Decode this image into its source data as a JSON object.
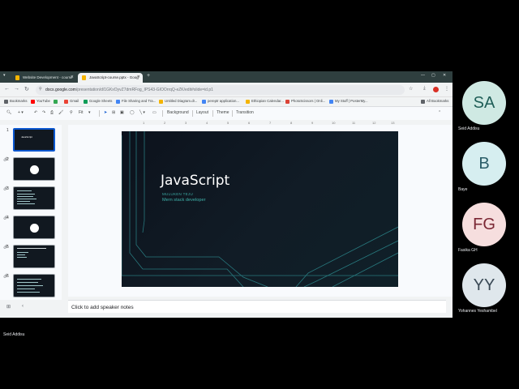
{
  "browser": {
    "tabs": [
      {
        "title": "Website Development - course"
      },
      {
        "title": "JavaScript-course.pptx - Goog"
      }
    ],
    "new_tab": "+",
    "url_host": "docs.google.com",
    "url_path": "/presentation/d/1GKxOyvZ7dmRFog_IPS43-GIOOrrqQ-eZK/edit#slide=id.p1",
    "bookmarks": [
      {
        "label": "Bookmarks",
        "color": "#5f6368"
      },
      {
        "label": "YouTube",
        "color": "#ff0000"
      },
      {
        "label": "",
        "color": "#34a853"
      },
      {
        "label": "Gmail",
        "color": "#ea4335"
      },
      {
        "label": "Google Sheets",
        "color": "#0f9d58"
      },
      {
        "label": "File Sharing and Tra...",
        "color": "#4285f4"
      },
      {
        "label": "Untitled Diagram.dr...",
        "color": "#f4b400"
      },
      {
        "label": "pereptr application...",
        "color": "#4285f4"
      },
      {
        "label": "Ethiopian Calendar...",
        "color": "#f4b400"
      },
      {
        "label": "PhotoScissors | Onli...",
        "color": "#db4437"
      },
      {
        "label": "My Stuff | PosterMy...",
        "color": "#4285f4"
      }
    ],
    "all_bookmarks": "All Bookmarks"
  },
  "slides_toolbar": {
    "zoom": "Fit",
    "background": "Background",
    "layout": "Layout",
    "theme": "Theme",
    "transition": "Transition"
  },
  "ruler_numbers": [
    "1",
    "2",
    "3",
    "4",
    "5",
    "6",
    "7",
    "8",
    "9",
    "10",
    "11",
    "12",
    "13"
  ],
  "filmstrip": {
    "slide_numbers": [
      "1",
      "2",
      "3",
      "4",
      "5",
      "6"
    ],
    "slide1_title": "JavaScript"
  },
  "slide": {
    "title": "JavaScript",
    "author": "MULUKEN TEJU",
    "role": "Mern stack developer"
  },
  "notes_placeholder": "Click to add speaker notes",
  "participants": [
    {
      "initials": "SA",
      "name": "Seid Addisu",
      "bg": "#cfe9e3",
      "fg": "#1f5e57"
    },
    {
      "initials": "B",
      "name": "Baye",
      "bg": "#d6eef0",
      "fg": "#2a5d68"
    },
    {
      "initials": "FG",
      "name": "Fasika GH",
      "bg": "#f6dede",
      "fg": "#7a2734"
    },
    {
      "initials": "YY",
      "name": "Yohannes Yeshambel",
      "bg": "#dfe7ec",
      "fg": "#3b4a56"
    }
  ],
  "presenter": "Seid Addisu"
}
